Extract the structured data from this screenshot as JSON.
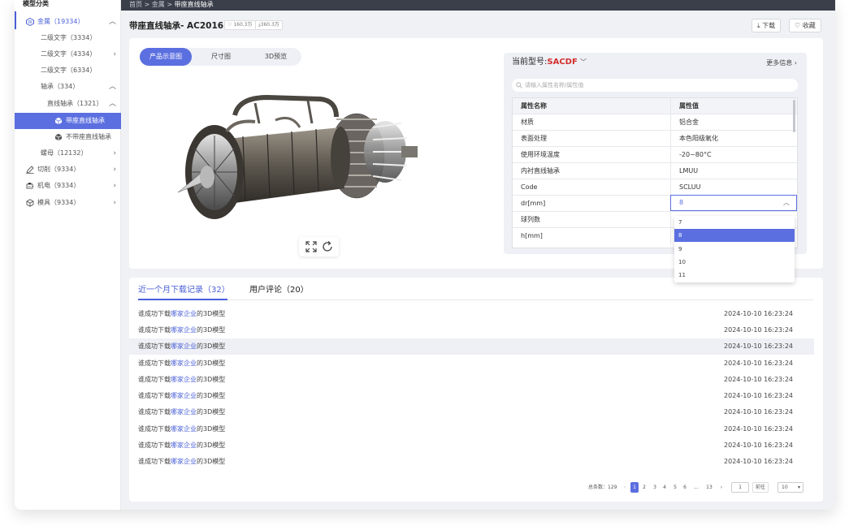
{
  "sidebar": {
    "title": "模型分类",
    "items": [
      {
        "label": "金属（19334）"
      },
      {
        "label": "二级文字（3334）"
      },
      {
        "label": "二级文字（4334）"
      },
      {
        "label": "二级文字（6334）"
      },
      {
        "label": "轴承（334）"
      },
      {
        "label": "直线轴承（1321）"
      },
      {
        "label": "带座直线轴承"
      },
      {
        "label": "不带座直线轴承"
      },
      {
        "label": "螺母（12132）"
      },
      {
        "label": "切削（9334）"
      },
      {
        "label": "机电（9334）"
      },
      {
        "label": "模具（9334）"
      }
    ]
  },
  "breadcrumb": {
    "home": "首页",
    "sep": ">",
    "level1": "金属",
    "current": "带座直线轴承"
  },
  "header": {
    "title": "带座直线轴承- AC2016",
    "likes": "160.3万",
    "downloads": "360.3万",
    "download_label": "下载",
    "favorite_label": "收藏"
  },
  "view_tabs": [
    {
      "label": "产品示意图"
    },
    {
      "label": "尺寸图"
    },
    {
      "label": "3D预览"
    }
  ],
  "props": {
    "current_model_label": "当前型号:",
    "current_model": "SACDF",
    "more_info": "更多信息",
    "search_placeholder": "请输入属性名称/属性值",
    "col_name": "属性名称",
    "col_value": "属性值",
    "rows": [
      {
        "name": "材质",
        "value": "铝合金"
      },
      {
        "name": "表面处理",
        "value": "本色阳级氧化"
      },
      {
        "name": "使用环境温度",
        "value": "-20~80°C"
      },
      {
        "name": "内衬直线轴承",
        "value": "LMUU"
      },
      {
        "name": "Code",
        "value": "SCLUU"
      },
      {
        "name": "dr[mm]",
        "value": "8"
      },
      {
        "name": "球列数",
        "value": ""
      },
      {
        "name": "h[mm]",
        "value": ""
      }
    ],
    "dropdown_options": [
      "7",
      "8",
      "9",
      "10",
      "11"
    ]
  },
  "records": {
    "tab1": "近一个月下载记录（32）",
    "tab2": "用户评论（20）",
    "prefix": "谁成功下载",
    "company": "哪家企业",
    "suffix": "的3D模型",
    "time": "2024-10-10   16:23:24"
  },
  "pager": {
    "total_label": "总条数：129",
    "pages": [
      "1",
      "2",
      "3",
      "4",
      "5",
      "6",
      "...",
      "13"
    ],
    "goto_value": "1",
    "goto_label": "前往",
    "page_size": "10"
  },
  "colors": {
    "accent": "#5b6fe0",
    "model": "#d42e2e",
    "topbar": "#3b3f4a"
  }
}
